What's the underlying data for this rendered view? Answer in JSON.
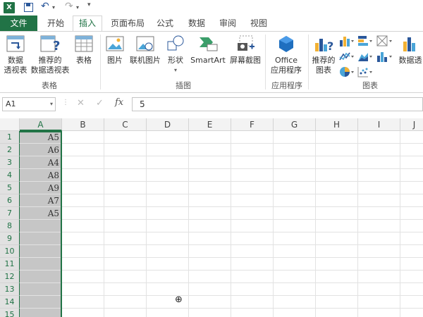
{
  "qat": {
    "app_icon": "X",
    "undo_icon": "undo-icon",
    "redo_icon": "redo-icon"
  },
  "tabs": [
    {
      "label": "文件"
    },
    {
      "label": "开始"
    },
    {
      "label": "插入"
    },
    {
      "label": "页面布局"
    },
    {
      "label": "公式"
    },
    {
      "label": "数据"
    },
    {
      "label": "审阅"
    },
    {
      "label": "视图"
    }
  ],
  "ribbon": {
    "pivot_line1": "数据",
    "pivot_line2": "透视表",
    "rec_pivot_line1": "推荐的",
    "rec_pivot_line2": "数据透视表",
    "table": "表格",
    "group_tables": "表格",
    "picture": "图片",
    "online_picture": "联机图片",
    "shapes": "形状",
    "smartart": "SmartArt",
    "screenshot": "屏幕截图",
    "group_illustrations": "插图",
    "office_line1": "Office",
    "office_line2": "应用程序",
    "group_apps": "应用程序",
    "rec_charts_line1": "推荐的",
    "rec_charts_line2": "图表",
    "group_charts": "图表",
    "pivot_chart": "数据透"
  },
  "formula_bar": {
    "name_box": "A1",
    "formula": "5",
    "fx": "fx",
    "cancel": "✕",
    "enter": "✓"
  },
  "columns": [
    "A",
    "B",
    "C",
    "D",
    "E",
    "F",
    "G",
    "H",
    "I",
    "J"
  ],
  "rows": [
    "1",
    "2",
    "3",
    "4",
    "5",
    "6",
    "7",
    "8",
    "9",
    "10",
    "11",
    "12",
    "13",
    "14",
    "15"
  ],
  "cells_A": [
    "A5",
    "A6",
    "A4",
    "A8",
    "A9",
    "A7",
    "A5"
  ],
  "colors": {
    "accent": "#217346",
    "selection": "#c6c6c6"
  }
}
